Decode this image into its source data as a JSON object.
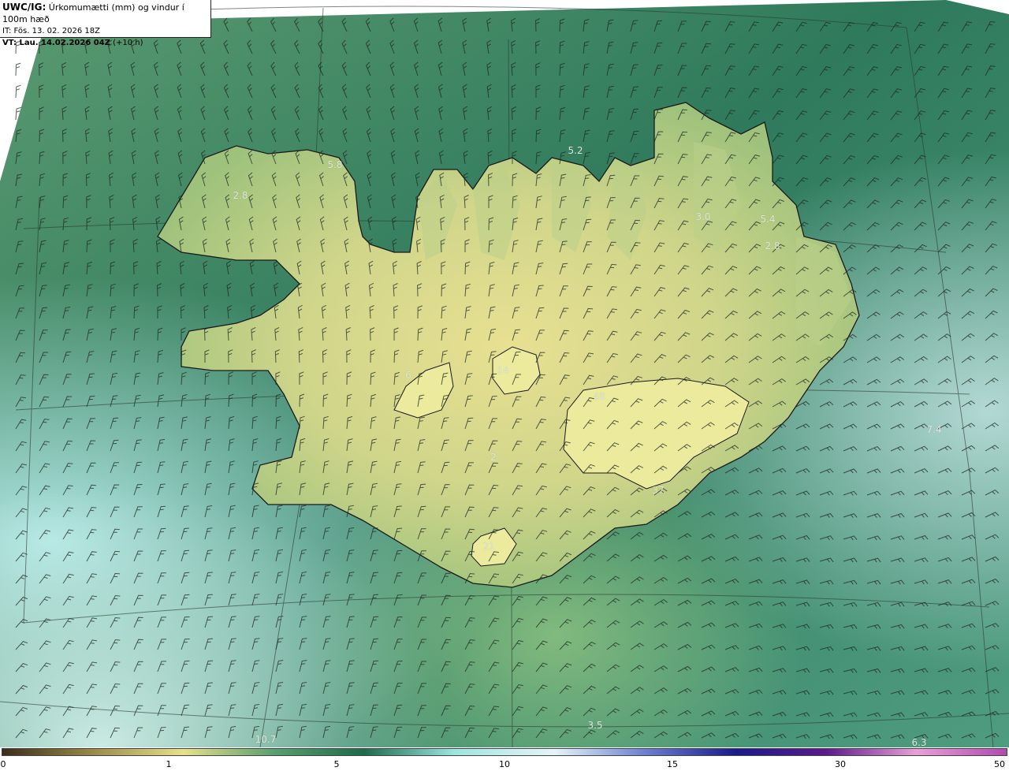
{
  "header": {
    "product": "UWC/IG:",
    "title": "Úrkomumætti (mm) og vindur í 100m hæð",
    "init_time": "IT: Fös. 13. 02. 2026 18Z",
    "valid_label": "VT: Lau. 14.02.2026 04Z",
    "lead": "(+10 h)"
  },
  "map": {
    "labels": [
      {
        "id": "w1",
        "text": "5.8"
      },
      {
        "id": "w2",
        "text": "2.8"
      },
      {
        "id": "n1",
        "text": "5.2"
      },
      {
        "id": "ne1",
        "text": "3.0"
      },
      {
        "id": "ne2",
        "text": "5.4"
      },
      {
        "id": "ne3",
        "text": "2.8"
      },
      {
        "id": "c1",
        "text": "14"
      },
      {
        "id": "c2",
        "text": "6"
      },
      {
        "id": "c3",
        "text": "48"
      },
      {
        "id": "c4",
        "text": "2"
      },
      {
        "id": "s1",
        "text": "21"
      },
      {
        "id": "se1",
        "text": "37"
      },
      {
        "id": "e1",
        "text": "7.4"
      },
      {
        "id": "b1",
        "text": "3.5"
      },
      {
        "id": "b2",
        "text": "10.7"
      },
      {
        "id": "b3",
        "text": "6.3"
      }
    ]
  },
  "colorbar": {
    "ticks": [
      "0",
      "1",
      "5",
      "10",
      "15",
      "30",
      "50"
    ],
    "colors": [
      "#3b2d1a",
      "#9a8a4a",
      "#e6e08a",
      "#5aa070",
      "#1e6a4a",
      "#9ee4e0",
      "#e6f4f8",
      "#6a80d0",
      "#1a1a8a",
      "#5a1a8a",
      "#e8a0d8",
      "#b04ab0"
    ]
  }
}
